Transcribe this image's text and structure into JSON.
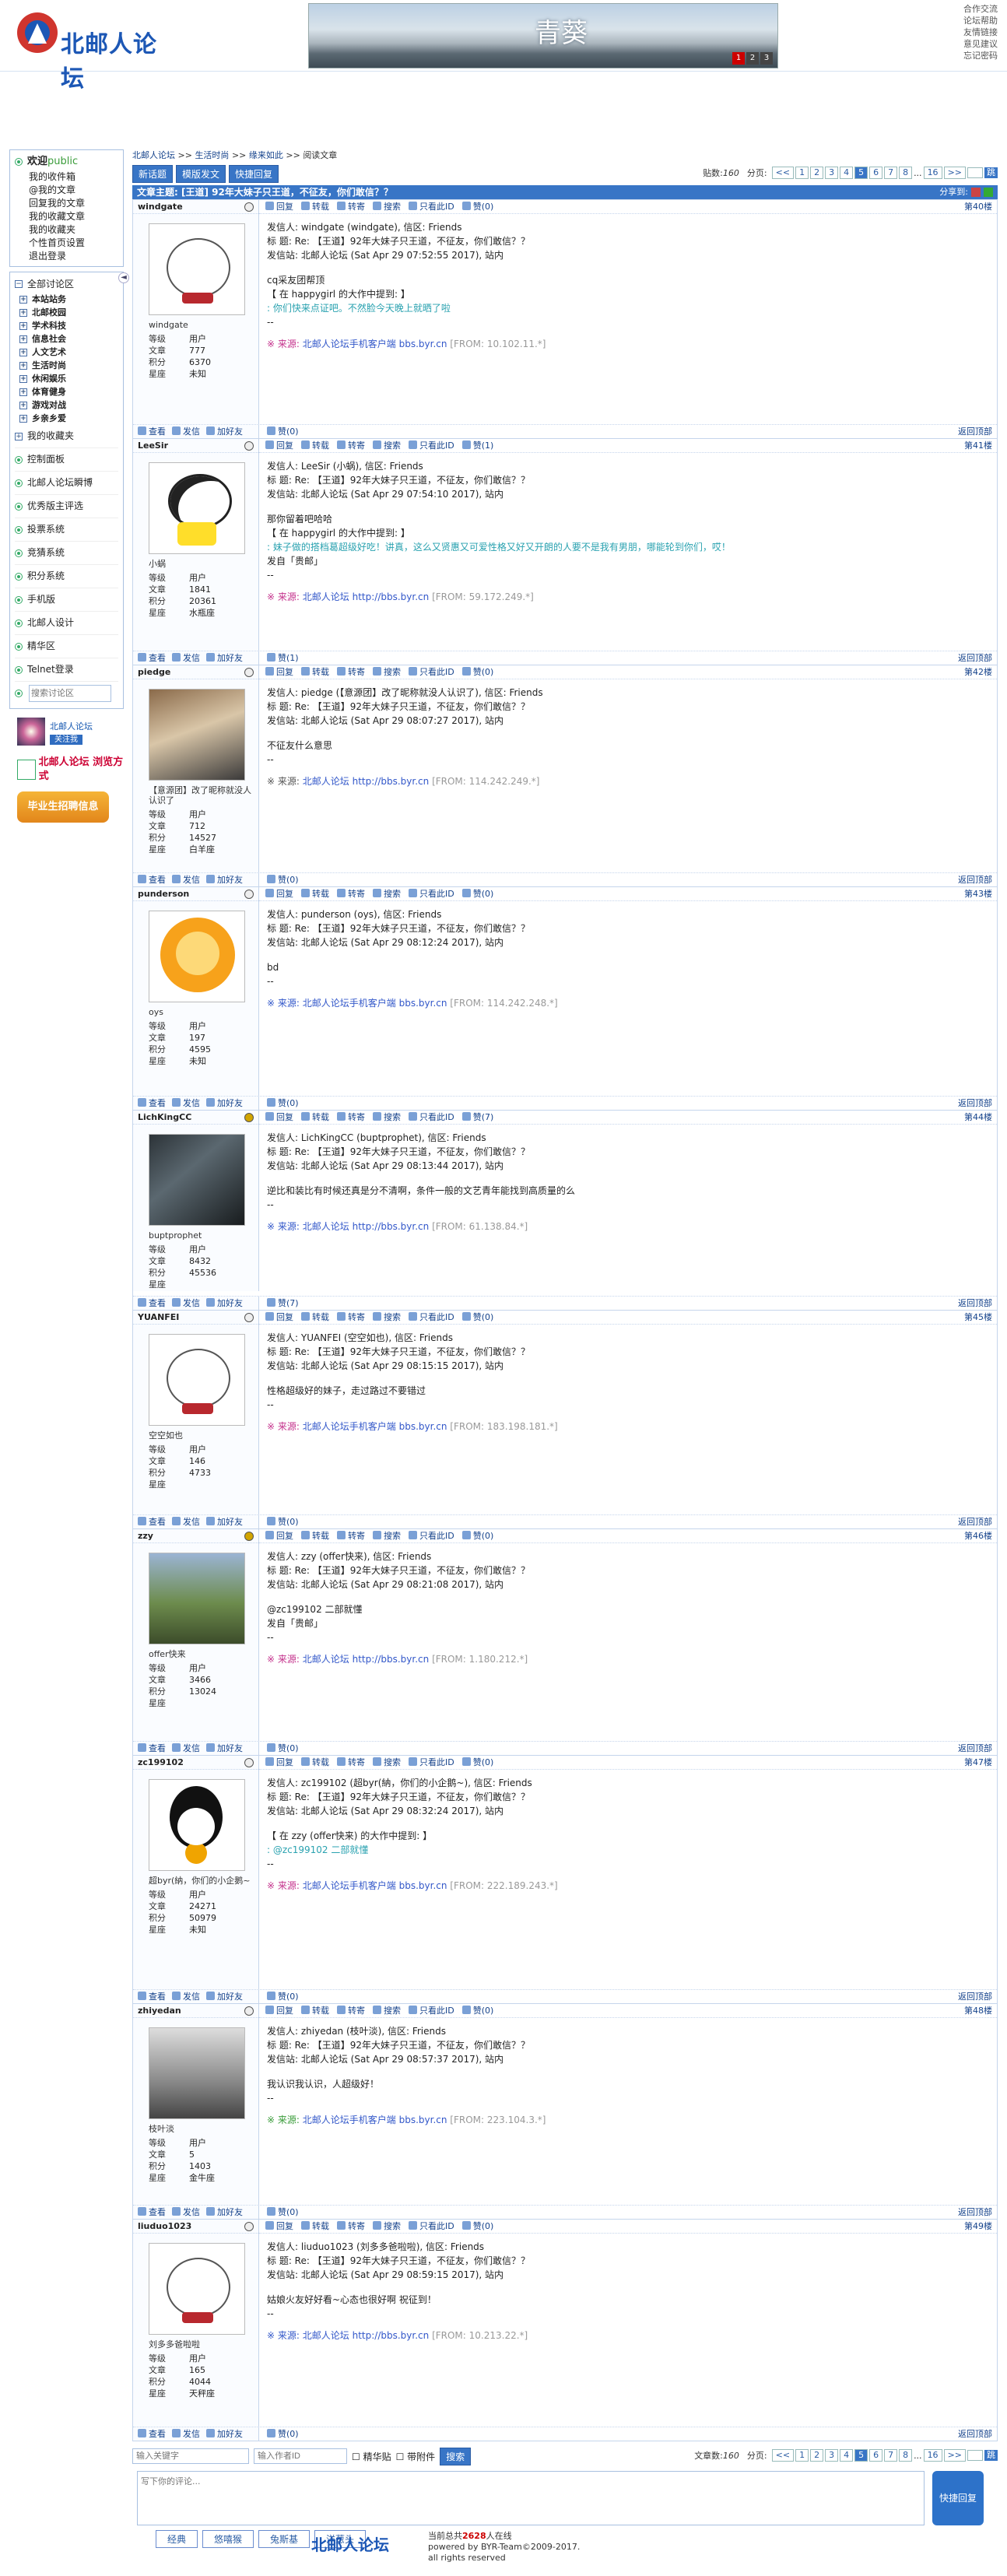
{
  "header": {
    "logo": "北邮人论坛",
    "banner_title": "青葵",
    "banner_pages": [
      "1",
      "2",
      "3"
    ],
    "links": [
      "合作交流",
      "论坛帮助",
      "友情链接",
      "意见建议",
      "忘记密码"
    ]
  },
  "sidebar": {
    "welcome": "欢迎",
    "user": "public",
    "user_links": [
      "我的收件箱",
      "@我的文章",
      "回复我的文章",
      "我的收藏文章",
      "我的收藏夹",
      "个性首页设置",
      "退出登录"
    ],
    "all_boards": "全部讨论区",
    "boards": [
      "本站站务",
      "北邮校园",
      "学术科技",
      "信息社会",
      "人文艺术",
      "生活时尚",
      "休闲娱乐",
      "体育健身",
      "游戏对战",
      "乡亲乡爱"
    ],
    "items": [
      "我的收藏夹",
      "控制面板",
      "北邮人论坛瞬博",
      "优秀版主评选",
      "投票系统",
      "竞猜系统",
      "积分系统",
      "手机版",
      "北邮人设计",
      "精华区",
      "Telnet登录"
    ],
    "search_placeholder": "搜索讨论区",
    "ad1_text": "北邮人论坛",
    "ad1_btn": "关注我",
    "ad2_text": "北邮人论坛 浏览方式",
    "ad3_text": "毕业生招聘信息",
    "collapse": "◄"
  },
  "crumb": [
    "北邮人论坛",
    ">>",
    "生活时尚",
    ">>",
    "缘来如此",
    ">>",
    "阅读文章"
  ],
  "toolbar": {
    "new": "新话题",
    "mode": "模版发文",
    "quick": "快捷回复"
  },
  "pager": {
    "label": "贴数:",
    "count": "160",
    "pages_label": "分页:",
    "pages": [
      "<<",
      "1",
      "2",
      "3",
      "4",
      "5",
      "6",
      "7",
      "8",
      "...",
      "16",
      ">>"
    ],
    "current": "5",
    "go": "跳"
  },
  "topic": {
    "label": "文章主题:",
    "title": "[王道] 92年大妹子只王道，不征友，你们敢信？？",
    "share": "分享到:"
  },
  "actions": [
    "回复",
    "转载",
    "转寄",
    "搜索",
    "只看此ID"
  ],
  "foot_actions": [
    "查看",
    "发信",
    "加好友"
  ],
  "back_top": "返回顶部",
  "stat_labels": [
    "等级",
    "文章",
    "积分",
    "星座"
  ],
  "posts": [
    {
      "id": "windgate",
      "online": false,
      "avatar": "av-bear",
      "nick": "windgate",
      "stats": [
        "用户",
        "777",
        "6370",
        "未知"
      ],
      "floor": "第40楼",
      "likes": "赞(0)",
      "foot_likes": "赞(0)",
      "lines": [
        "发信人: windgate (windgate), 信区: Friends",
        "标  题: Re: 【王道】92年大妹子只王道，不征友，你们敢信？？",
        "发信站: 北邮人论坛 (Sat Apr 29 07:52:55 2017), 站内"
      ],
      "extra": [
        "cq采友团帮顶",
        "【 在 happygirl 的大作中提到: 】",
        ": 你们快来点证吧。不然脸今天晚上就晒了啦",
        "--"
      ],
      "src_label": "※ 来源:",
      "src_site": "北邮人论坛手机客户端",
      "src_url": "bbs.byr.cn",
      "src_ip": "[FROM: 10.102.11.*]",
      "src_color": "#c4328c"
    },
    {
      "id": "LeeSir",
      "online": false,
      "avatar": "av-panda",
      "nick": "小蜗",
      "stats": [
        "用户",
        "1841",
        "20361",
        "水瓶座"
      ],
      "floor": "第41楼",
      "likes": "赞(1)",
      "foot_likes": "赞(1)",
      "lines": [
        "发信人: LeeSir (小蜗), 信区: Friends",
        "标  题: Re: 【王道】92年大妹子只王道，不征友，你们敢信？？",
        "发信站: 北邮人论坛 (Sat Apr 29 07:54:10 2017), 站内"
      ],
      "extra": [
        "那你留着吧哈哈",
        "【 在 happygirl 的大作中提到: 】",
        ": 妹子做的搭档葛超级好吃！讲真，这么又贤惠又可爱性格又好又开朗的人要不是我有男朋，哪能轮到你们，哎！",
        "发自「贵邮」",
        "--"
      ],
      "src_label": "※ 来源:",
      "src_site": "北邮人论坛",
      "src_url": "http://bbs.byr.cn",
      "src_ip": "[FROM: 59.172.249.*]",
      "src_color": "#c4328c"
    },
    {
      "id": "piedge",
      "online": false,
      "avatar": "av-photo1",
      "nick": "【意源团】改了昵称就没人认识了",
      "stats": [
        "用户",
        "712",
        "14527",
        "白羊座"
      ],
      "floor": "第42楼",
      "likes": "赞(0)",
      "foot_likes": "赞(0)",
      "lines": [
        "发信人: piedge (【意源团】改了昵称就没人认识了), 信区: Friends",
        "标  题: Re: 【王道】92年大妹子只王道，不征友，你们敢信？？",
        "发信站: 北邮人论坛 (Sat Apr 29 08:07:27 2017), 站内"
      ],
      "extra": [
        "不征友什么意思",
        "--"
      ],
      "src_label": "※ 来源:",
      "src_site": "北邮人论坛",
      "src_url": "http://bbs.byr.cn",
      "src_ip": "[FROM: 114.242.249.*]",
      "src_color": "#555"
    },
    {
      "id": "punderson",
      "online": false,
      "avatar": "av-lion",
      "nick": "oys",
      "stats": [
        "用户",
        "197",
        "4595",
        "未知"
      ],
      "floor": "第43楼",
      "likes": "赞(0)",
      "foot_likes": "赞(0)",
      "lines": [
        "发信人: punderson (oys), 信区: Friends",
        "标  题: Re: 【王道】92年大妹子只王道，不征友，你们敢信？？",
        "发信站: 北邮人论坛 (Sat Apr 29 08:12:24 2017), 站内"
      ],
      "extra": [
        "bd",
        "--"
      ],
      "src_label": "※ 来源:",
      "src_site": "北邮人论坛手机客户端",
      "src_url": "bbs.byr.cn",
      "src_ip": "[FROM: 114.242.248.*]",
      "src_color": "#3257c9"
    },
    {
      "id": "LichKingCC",
      "online": true,
      "avatar": "av-dark",
      "nick": "buptprophet",
      "stats": [
        "用户",
        "8432",
        "45536",
        ""
      ],
      "floor": "第44楼",
      "likes": "赞(7)",
      "foot_likes": "赞(7)",
      "lines": [
        "发信人: LichKingCC (buptprophet), 信区: Friends",
        "标  题: Re: 【王道】92年大妹子只王道，不征友，你们敢信？？",
        "发信站: 北邮人论坛 (Sat Apr 29 08:13:44 2017), 站内"
      ],
      "extra": [
        "逆比和装比有时候还真是分不清啊，条件一般的文艺青年能找到高质量的么",
        "--"
      ],
      "src_label": "※ 来源:",
      "src_site": "北邮人论坛",
      "src_url": "http://bbs.byr.cn",
      "src_ip": "[FROM: 61.138.84.*]",
      "src_color": "#3257c9"
    },
    {
      "id": "YUANFEI",
      "online": false,
      "avatar": "av-bear",
      "nick": "空空如也",
      "stats": [
        "用户",
        "146",
        "4733",
        ""
      ],
      "floor": "第45楼",
      "likes": "赞(0)",
      "foot_likes": "赞(0)",
      "lines": [
        "发信人: YUANFEI (空空如也), 信区: Friends",
        "标  题: Re: 【王道】92年大妹子只王道，不征友，你们敢信？？",
        "发信站: 北邮人论坛 (Sat Apr 29 08:15:15 2017), 站内"
      ],
      "extra": [
        "性格超级好的妹子，走过路过不要错过",
        "--"
      ],
      "src_label": "※ 来源:",
      "src_site": "北邮人论坛手机客户端",
      "src_url": "bbs.byr.cn",
      "src_ip": "[FROM: 183.198.181.*]",
      "src_color": "#c4328c"
    },
    {
      "id": "zzy",
      "online": true,
      "avatar": "av-run",
      "nick": "offer快来",
      "stats": [
        "用户",
        "3466",
        "13024",
        ""
      ],
      "floor": "第46楼",
      "likes": "赞(0)",
      "foot_likes": "赞(0)",
      "lines": [
        "发信人: zzy (offer快来), 信区: Friends",
        "标  题: Re: 【王道】92年大妹子只王道，不征友，你们敢信？？",
        "发信站: 北邮人论坛 (Sat Apr 29 08:21:08 2017), 站内"
      ],
      "extra": [
        "@zc199102 二部就懂",
        "发自「贵邮」",
        "--"
      ],
      "src_label": "※ 来源:",
      "src_site": "北邮人论坛",
      "src_url": "http://bbs.byr.cn",
      "src_ip": "[FROM: 1.180.212.*]",
      "src_color": "#c4328c"
    },
    {
      "id": "zc199102",
      "online": false,
      "avatar": "av-peng",
      "nick": "超byr(納，你们的小企鹅~",
      "stats": [
        "用户",
        "24271",
        "50979",
        "未知"
      ],
      "floor": "第47楼",
      "likes": "赞(0)",
      "foot_likes": "赞(0)",
      "lines": [
        "发信人: zc199102 (超byr(納，你们的小企鹅~), 信区: Friends",
        "标  题: Re: 【王道】92年大妹子只王道，不征友，你们敢信？？",
        "发信站: 北邮人论坛 (Sat Apr 29 08:32:24 2017), 站内"
      ],
      "extra": [
        "【 在 zzy (offer快来) 的大作中提到: 】",
        ": @zc199102 二部就懂",
        "--"
      ],
      "src_label": "※ 来源:",
      "src_site": "北邮人论坛手机客户端",
      "src_url": "bbs.byr.cn",
      "src_ip": "[FROM: 222.189.243.*]",
      "src_color": "#c4328c"
    },
    {
      "id": "zhiyedan",
      "online": false,
      "avatar": "av-horse",
      "nick": "枝叶淡",
      "stats": [
        "用户",
        "5",
        "1403",
        "金牛座"
      ],
      "floor": "第48楼",
      "likes": "赞(0)",
      "foot_likes": "赞(0)",
      "lines": [
        "发信人: zhiyedan (枝叶淡), 信区: Friends",
        "标  题: Re: 【王道】92年大妹子只王道，不征友，你们敢信？？",
        "发信站: 北邮人论坛 (Sat Apr 29 08:57:37 2017), 站内"
      ],
      "extra": [
        "我认识我认识，人超级好！",
        "--"
      ],
      "src_label": "※ 来源:",
      "src_site": "北邮人论坛手机客户端",
      "src_url": "bbs.byr.cn",
      "src_ip": "[FROM: 223.104.3.*]",
      "src_color": "#3a9c3a"
    },
    {
      "id": "liuduo1023",
      "online": false,
      "avatar": "av-bear",
      "nick": "刘多多爸啦啦",
      "stats": [
        "用户",
        "165",
        "4044",
        "天秤座"
      ],
      "floor": "第49楼",
      "likes": "赞(0)",
      "foot_likes": "赞(0)",
      "lines": [
        "发信人: liuduo1023 (刘多多爸啦啦), 信区: Friends",
        "标  题: Re: 【王道】92年大妹子只王道，不征友，你们敢信？？",
        "发信站: 北邮人论坛 (Sat Apr 29 08:59:15 2017), 站内"
      ],
      "extra": [
        "姑娘火友好好看~心态也很好啊 祝征到！",
        "--"
      ],
      "src_label": "※ 来源:",
      "src_site": "北邮人论坛",
      "src_url": "http://bbs.byr.cn",
      "src_ip": "[FROM: 10.213.22.*]",
      "src_color": "#3257c9"
    }
  ],
  "bottom": {
    "kw_placeholder": "输入关键字",
    "author_placeholder": "输入作者ID",
    "opt1": "精华贴",
    "opt2": "带附件",
    "search": "搜索",
    "count_label": "文章数:",
    "count": "160"
  },
  "reply": {
    "placeholder": "写下你的评论...",
    "button": "快捷回复"
  },
  "emotion_tabs": [
    "经典",
    "悠嘻猴",
    "兔斯基",
    "洋葱头"
  ],
  "footer": {
    "logo": "北邮人论坛",
    "online_prefix": "当前总共",
    "online_count": "2628",
    "online_suffix": "人在线",
    "powered": "powered by BYR-Team©2009-2017.",
    "rights": "all rights reserved"
  }
}
